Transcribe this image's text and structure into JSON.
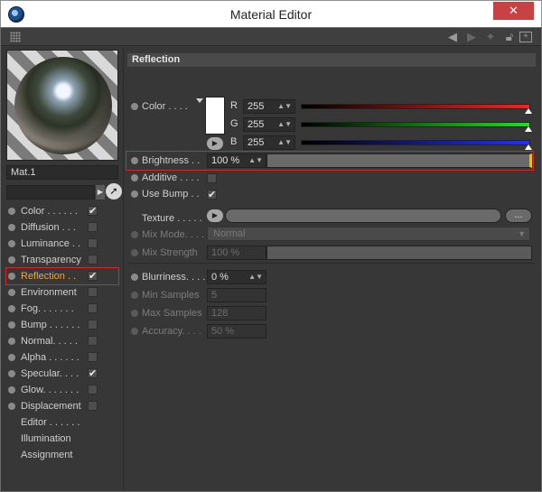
{
  "window": {
    "title": "Material Editor",
    "close_label": "✕"
  },
  "toolbar": {
    "icons": [
      "grip-icon",
      "back-arrow-icon",
      "forward-arrow-icon",
      "pin-icon",
      "lock-icon",
      "new-window-icon"
    ]
  },
  "material": {
    "name": "Mat.1"
  },
  "channels": [
    {
      "label": "Color . . . . . .",
      "checked": true
    },
    {
      "label": "Diffusion . . .",
      "checked": false
    },
    {
      "label": "Luminance . .",
      "checked": false
    },
    {
      "label": "Transparency",
      "checked": false
    },
    {
      "label": "Reflection . .",
      "checked": true,
      "active": true
    },
    {
      "label": "Environment",
      "checked": false
    },
    {
      "label": "Fog. . . . . . .",
      "checked": false
    },
    {
      "label": "Bump . . . . . .",
      "checked": false
    },
    {
      "label": "Normal. . . . .",
      "checked": false
    },
    {
      "label": "Alpha . . . . . .",
      "checked": false
    },
    {
      "label": "Specular. . . .",
      "checked": true
    },
    {
      "label": "Glow. . . . . . .",
      "checked": false
    },
    {
      "label": "Displacement",
      "checked": false
    }
  ],
  "extra_items": [
    "Editor . . . . . .",
    "Illumination",
    "Assignment"
  ],
  "reflection": {
    "header": "Reflection",
    "color_label": "Color . . . .",
    "r_label": "R",
    "g_label": "G",
    "b_label": "B",
    "r": "255",
    "g": "255",
    "b": "255",
    "brightness_label": "Brightness . .",
    "brightness": "100 %",
    "additive_label": "Additive . . . .",
    "use_bump_label": "Use Bump . .",
    "texture_label": "Texture . . . . .",
    "texture_button": "...",
    "mix_mode_label": "Mix Mode. . . .",
    "mix_mode_value": "Normal",
    "mix_strength_label": "Mix Strength",
    "mix_strength": "100 %",
    "blurriness_label": "Blurriness. . . .",
    "blurriness": "0 %",
    "min_samples_label": "Min Samples",
    "min_samples": "5",
    "max_samples_label": "Max Samples",
    "max_samples": "128",
    "accuracy_label": "Accuracy. . . .",
    "accuracy": "50 %"
  },
  "colors": {
    "accent_red": "#d02a2a",
    "active_label": "#f0a640",
    "panel_bg": "#373737"
  }
}
